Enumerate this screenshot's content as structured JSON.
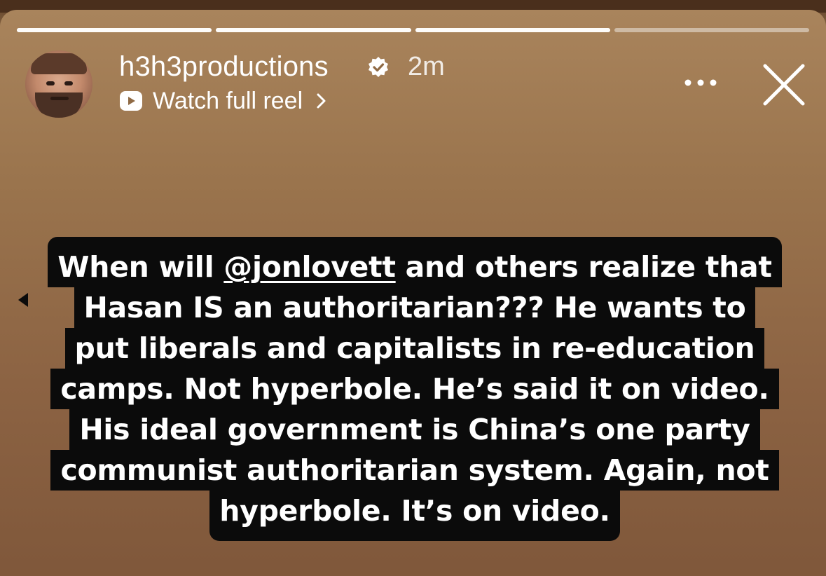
{
  "story": {
    "progress": [
      1,
      1,
      1,
      0
    ],
    "username": "h3h3productions",
    "timestamp": "2m",
    "verified_icon": "verified-badge-icon",
    "reel_link_label": "Watch full reel",
    "more_icon": "more-options-icon",
    "close_icon": "close-icon"
  },
  "caption": {
    "lines": [
      {
        "before": "When will ",
        "mention": "@jonlovett",
        "after": " and others realize that"
      },
      {
        "text": "Hasan IS an authoritarian??? He wants to"
      },
      {
        "text": "put liberals and capitalists in re-education"
      },
      {
        "text": "camps. Not hyperbole. He’s said it on video."
      },
      {
        "text": "His ideal government is China’s one party"
      },
      {
        "text": "communist authoritarian system. Again, not"
      },
      {
        "text": "hyperbole. It’s on video."
      }
    ]
  },
  "colors": {
    "caption_background": "#0b0b0b",
    "caption_text": "#ffffff",
    "story_background": "#96704a"
  }
}
